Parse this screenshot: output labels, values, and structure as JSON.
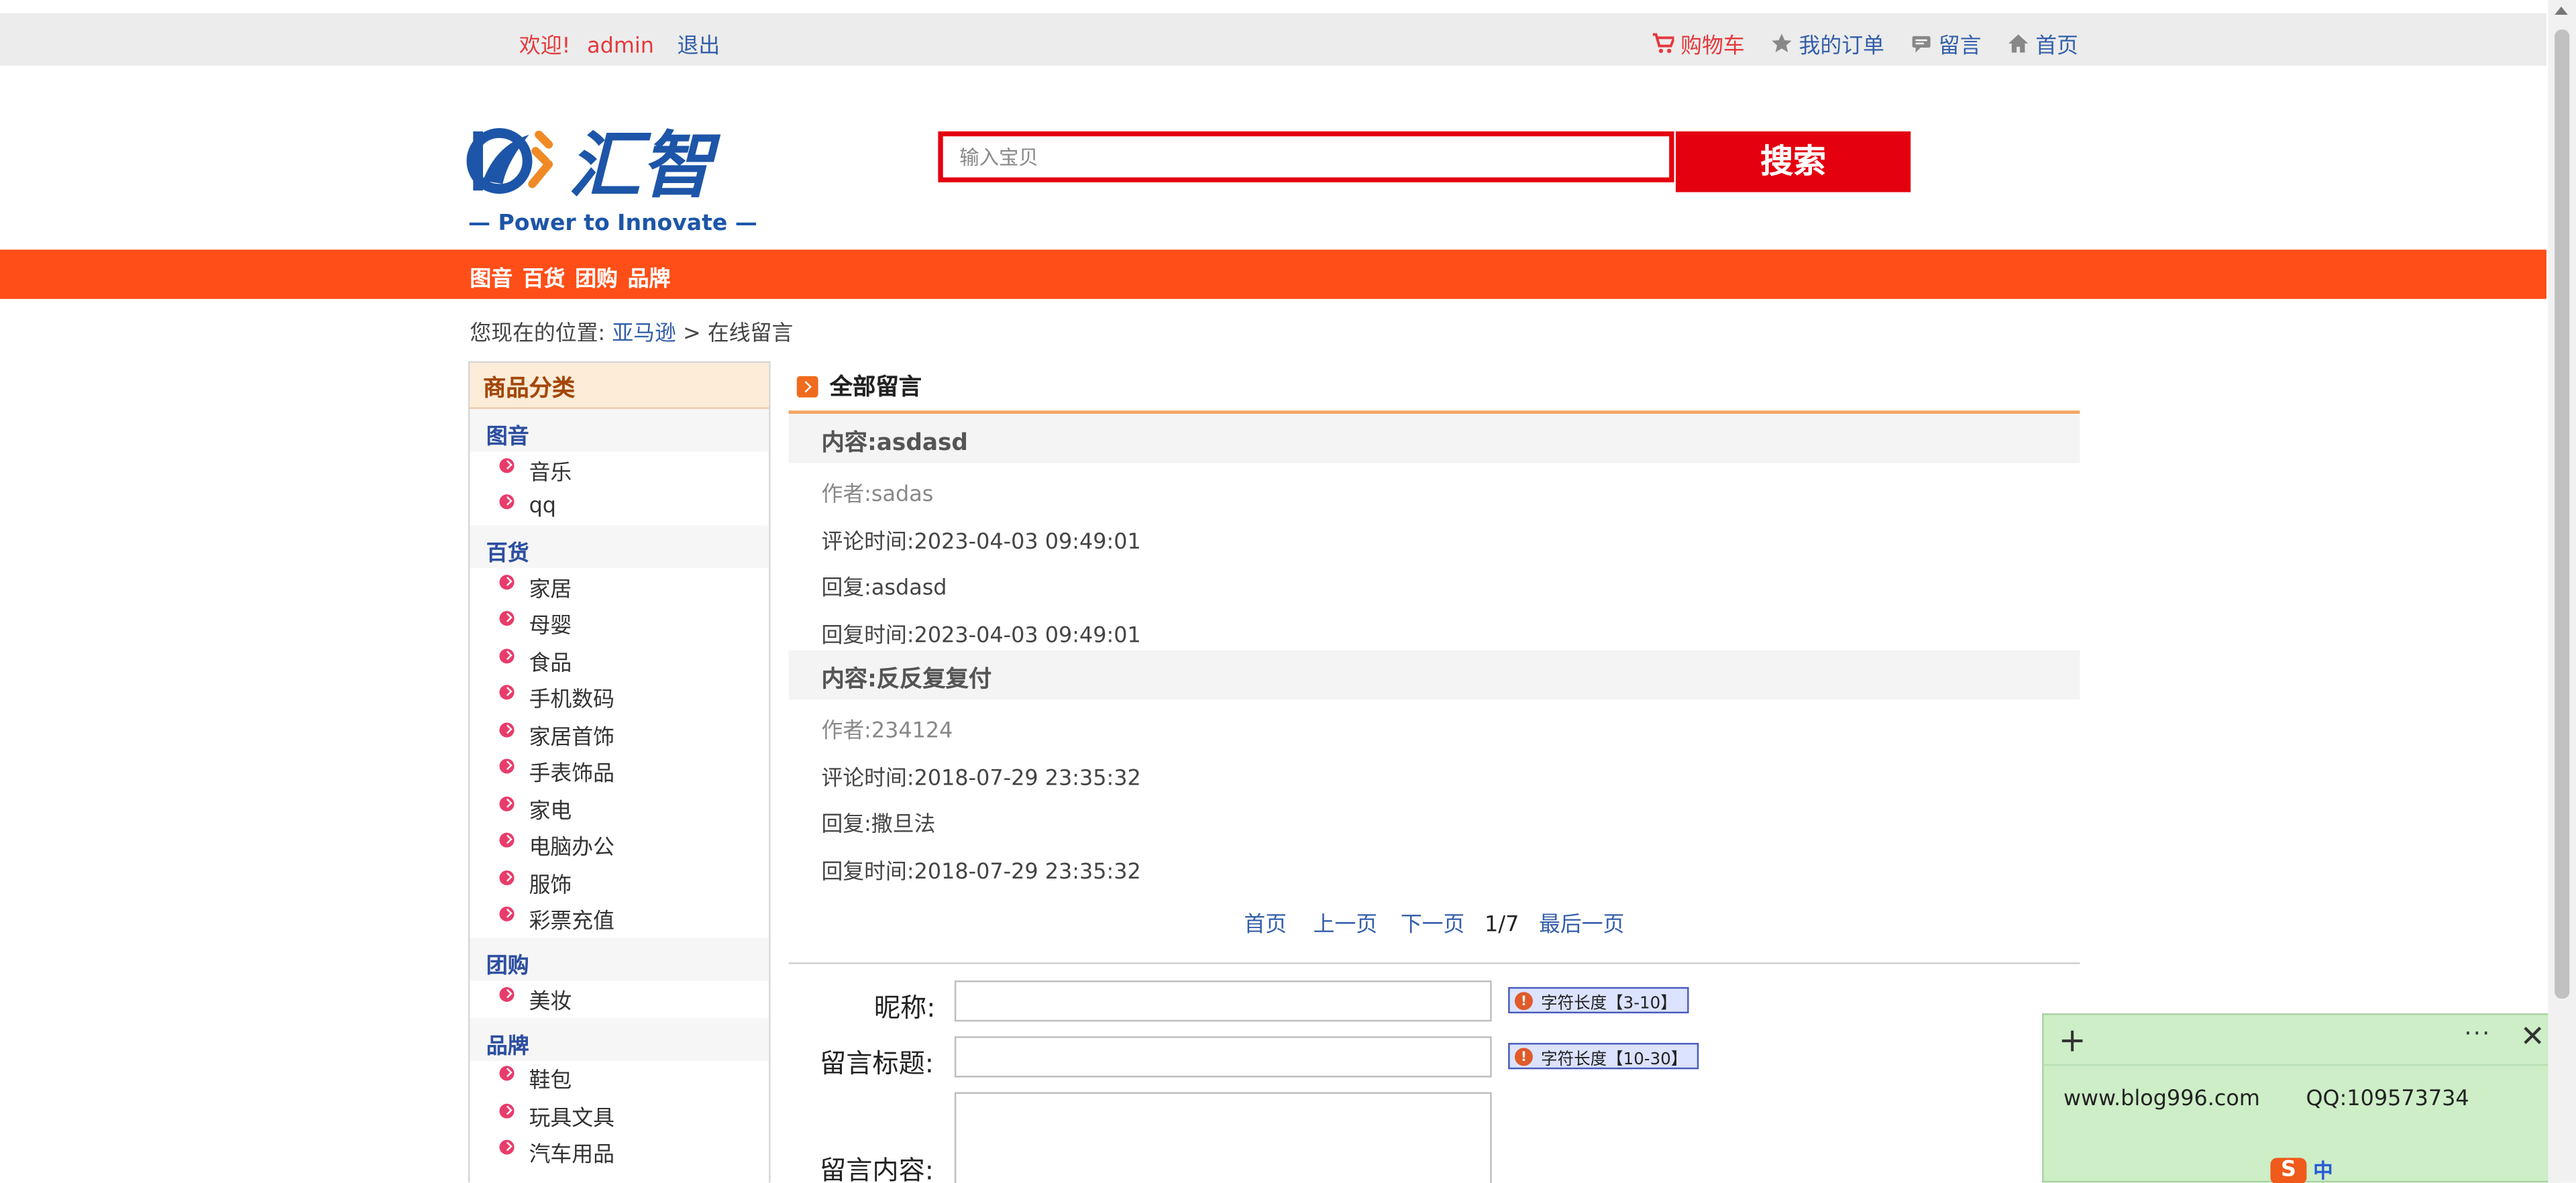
{
  "topbar": {
    "welcome": "欢迎!",
    "username": "admin",
    "logout": "退出",
    "cart": "购物车",
    "orders": "我的订单",
    "message": "留言",
    "home": "首页"
  },
  "header": {
    "logo_text": "汇智",
    "logo_tagline": "— Power to Innovate —",
    "search_placeholder": "输入宝贝",
    "search_button": "搜索"
  },
  "nav": [
    "图音",
    "百货",
    "团购",
    "品牌"
  ],
  "breadcrumb": {
    "prefix": "您现在的位置:",
    "link": "亚马逊",
    "current": "> 在线留言"
  },
  "sidebar": {
    "title": "商品分类",
    "categories": [
      {
        "name": "图音",
        "items": [
          "音乐",
          "qq"
        ]
      },
      {
        "name": "百货",
        "items": [
          "家居",
          "母婴",
          "食品",
          "手机数码",
          "家居首饰",
          "手表饰品",
          "家电",
          "电脑办公",
          "服饰",
          "彩票充值"
        ]
      },
      {
        "name": "团购",
        "items": [
          "美妆"
        ]
      },
      {
        "name": "品牌",
        "items": [
          "鞋包",
          "玩具文具",
          "汽车用品"
        ]
      }
    ]
  },
  "main": {
    "title": "全部留言",
    "messages": [
      {
        "content": "内容:asdasd",
        "author": "作者:sadas",
        "time": "评论时间:2023-04-03 09:49:01",
        "reply": "回复:asdasd",
        "reply_time": "回复时间:2023-04-03 09:49:01"
      },
      {
        "content": "内容:反反复复付",
        "author": "作者:234124",
        "time": "评论时间:2018-07-29 23:35:32",
        "reply": "回复:撒旦法",
        "reply_time": "回复时间:2018-07-29 23:35:32"
      }
    ]
  },
  "pager": {
    "first": "首页",
    "prev": "上一页",
    "next": "下一页",
    "current": "1/7",
    "last": "最后一页"
  },
  "form": {
    "nickname_label": "昵称:",
    "nickname_hint": "字符长度【3-10】",
    "title_label": "留言标题:",
    "title_hint": "字符长度【10-30】",
    "content_label": "留言内容:"
  },
  "sticky_note": {
    "site": "www.blog996.com",
    "qq": "QQ:109573734"
  },
  "ime": {
    "lang": "中"
  },
  "colors": {
    "accent_red": "#e4000f",
    "nav_orange": "#ff4e17",
    "link_blue": "#335eaa",
    "sticky_green": "#cdeec7"
  }
}
